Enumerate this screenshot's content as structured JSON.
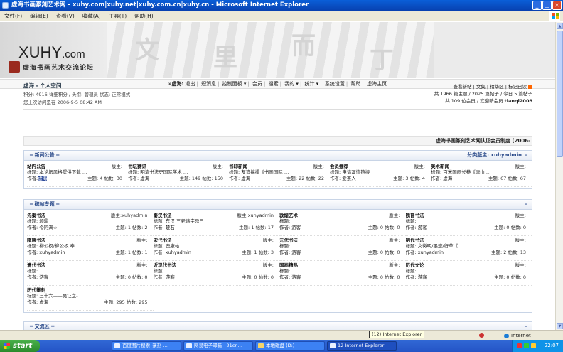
{
  "window": {
    "title": "虚海书画篆刻艺术网 - xuhy.com|xuhy.net|xuhy.com.cn|xuhy.cn - Microsoft Internet Explorer"
  },
  "menu": [
    "文件(F)",
    "编辑(E)",
    "查看(V)",
    "收藏(A)",
    "工具(T)",
    "帮助(H)"
  ],
  "banner": {
    "logo": "XUHY",
    "logo_suffix": ".com",
    "subtitle": "虚海书画艺术交流论坛"
  },
  "nav": [
    "»虚海:",
    "退出",
    "短消息",
    "控制面板 ▾",
    "会员",
    "搜索",
    "我的 ▾",
    "统计 ▾",
    "系统设置",
    "帮助",
    "虚海主页"
  ],
  "myspace": {
    "title": "虚海 - 个人空间",
    "points": "积分: 4916 详细积分 / 头衔: 管理员 状态: 正常模式",
    "last_visit": "您上次访问是在 2006-9-5 08:42 AM",
    "links": "查看新帖 | 文集 | 精华区 | 标记已读",
    "stats1": "共 1966 篇主题 / 2025 篇帖子 / 今日 5 篇帖子",
    "stats2": "共 109 位会员 / 欢迎新会员",
    "new_member": "tianqi2008"
  },
  "announcement": "虚海书画篆刻艺术网认证会员制度 (2006-",
  "sections": [
    {
      "title": "新闻公告",
      "moderators": "分类版主: xuhyadmin",
      "toggle": "–",
      "forums": [
        {
          "name": "站内公告",
          "mod": "版主:",
          "topic": "标题: 本论坛风格提供下载 …",
          "author": "作者:",
          "author_name": "虚海",
          "stats": "主题: 4 帖数: 30"
        },
        {
          "name": "书坛赛讯",
          "mod": "版主:",
          "topic": "标题: 明清书法史国际学术 …",
          "author": "作者: 虚海",
          "stats": "主题: 149 帖数: 150"
        },
        {
          "name": "书印新闻",
          "mod": "版主:",
          "topic": "标题: 友谊搞擂《书画国际 …",
          "author": "作者: 虚海",
          "stats": "主题: 22 帖数: 22"
        },
        {
          "name": "会员推荐",
          "mod": "版主:",
          "topic": "标题: 申请友情链接",
          "author": "作者: 爱茶人",
          "stats": "主题: 3 帖数: 4"
        },
        {
          "name": "美术新闻",
          "mod": "版主:",
          "topic": "标题: 百米国画长卷《唐山 …",
          "author": "作者: 虚海",
          "stats": "主题: 67 帖数: 67"
        }
      ]
    },
    {
      "title": "碑帖专题",
      "toggle": "–",
      "forums": [
        {
          "name": "先秦书法",
          "mod": "版主:xuhyadmin",
          "topic": "标题: 颂鼎",
          "author": "作者: 令阿满☆",
          "stats": "主题: 1 帖数: 2"
        },
        {
          "name": "秦汉书法",
          "mod": "版主:xuhyadmin",
          "topic": "标题: 东汉      三老讳字忌日",
          "author": "作者: 楚石",
          "stats": "主题: 1 帖数: 17"
        },
        {
          "name": "敦煌艺术",
          "mod": "版主:",
          "topic": "标题:",
          "author": "作者: 游客",
          "stats": "主题: 0 帖数: 0"
        },
        {
          "name": "魏晋书法",
          "mod": "版主:",
          "topic": "标题:",
          "author": "作者: 游客",
          "stats": "主题: 0 帖数: 0"
        },
        {
          "name": "隋唐书法",
          "mod": "版主:",
          "topic": "标题: 柳公权/柳公权  奉 …",
          "author": "作者: xuhyadmin",
          "stats": "主题: 1 帖数: 1"
        },
        {
          "name": "宋代书法",
          "mod": "版主:",
          "topic": "标题: 鹿康帖",
          "author": "作者: xuhyadmin",
          "stats": "主题: 1 帖数: 3"
        },
        {
          "name": "元代书法",
          "mod": "版主:",
          "topic": "标题:",
          "author": "作者: 游客",
          "stats": "主题: 0 帖数: 0"
        },
        {
          "name": "明代书法",
          "mod": "版主:",
          "topic": "标题: 文徵明/墨迹/行草《 …",
          "author": "作者: xuhyadmin",
          "stats": "主题: 2 帖数: 13"
        },
        {
          "name": "清代书法",
          "mod": "版主:",
          "topic": "标题:",
          "author": "作者: 游客",
          "stats": "主题: 0 帖数: 0"
        },
        {
          "name": "近现代书法",
          "mod": "版主:",
          "topic": "标题:",
          "author": "作者: 游客",
          "stats": "主题: 0 帖数: 0"
        },
        {
          "name": "国画精品",
          "mod": "版主:",
          "topic": "标题:",
          "author": "作者: 游客",
          "stats": "主题: 0 帖数: 0"
        },
        {
          "name": "历代文论",
          "mod": "版主:",
          "topic": "标题:",
          "author": "作者: 游客",
          "stats": "主题: 0 帖数: 0"
        },
        {
          "name": "历代篆刻",
          "mod": "",
          "topic": "标题: 三十六——吴让之- …",
          "author": "作者: 虚海",
          "stats": "主题: 295 帖数: 295"
        }
      ]
    },
    {
      "title": "交流区",
      "toggle": "–"
    }
  ],
  "statusbar": {
    "zone": "Internet",
    "tooltip": "(12) Internet Explorer"
  },
  "taskbar": {
    "start": "start",
    "items": [
      "百度图片搜索_篆刻 …",
      "网易电子邮箱 - 21cn…",
      "本地磁盘 (D:)",
      "12 Internet Explorer"
    ],
    "time": "22:07"
  }
}
